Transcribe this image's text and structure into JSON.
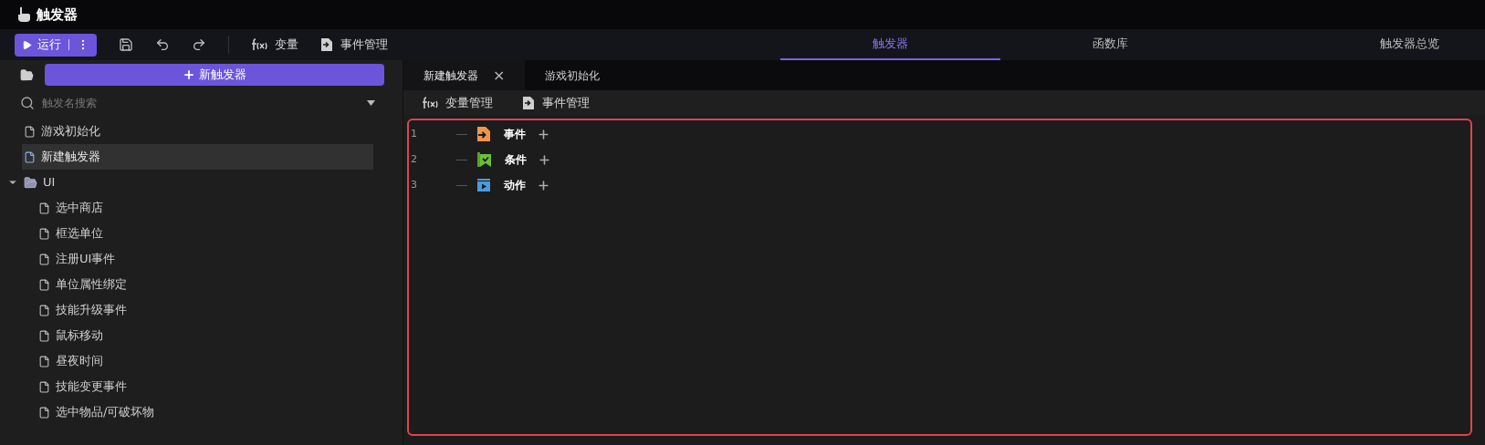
{
  "window": {
    "title": "触发器"
  },
  "toolbar": {
    "run_button": "运行",
    "items": [
      {
        "kind": "fx",
        "label": "变量"
      },
      {
        "kind": "event",
        "label": "事件管理"
      }
    ]
  },
  "top_tabs": [
    {
      "label": "触发器",
      "selected": true
    },
    {
      "label": "函数库",
      "selected": false
    },
    {
      "label": "触发器总览",
      "selected": false
    }
  ],
  "sidebar": {
    "new_button": "新触发器",
    "search": {
      "placeholder": "触发名搜索"
    },
    "items": [
      {
        "kind": "file",
        "label": "游戏初始化",
        "selected": false
      },
      {
        "kind": "file",
        "label": "新建触发器",
        "selected": true
      },
      {
        "kind": "folder",
        "label": "UI",
        "expanded": true,
        "children": [
          {
            "kind": "file",
            "label": "选中商店",
            "selected": false
          },
          {
            "kind": "file",
            "label": "框选单位",
            "selected": false
          },
          {
            "kind": "file",
            "label": "注册UI事件",
            "selected": false
          },
          {
            "kind": "file",
            "label": "单位属性绑定",
            "selected": false
          },
          {
            "kind": "file",
            "label": "技能升级事件",
            "selected": false
          },
          {
            "kind": "file",
            "label": "鼠标移动",
            "selected": false
          },
          {
            "kind": "file",
            "label": "昼夜时间",
            "selected": false
          },
          {
            "kind": "file",
            "label": "技能变更事件",
            "selected": false
          },
          {
            "kind": "file",
            "label": "选中物品/可破坏物",
            "selected": false
          }
        ]
      }
    ]
  },
  "editor_tabs": [
    {
      "label": "新建触发器",
      "selected": true,
      "close": "×"
    },
    {
      "label": "游戏初始化",
      "selected": false
    }
  ],
  "editor_toolbar": [
    {
      "kind": "fx",
      "label": "变量管理"
    },
    {
      "kind": "event",
      "label": "事件管理"
    }
  ],
  "editor_rows": [
    {
      "line": "1",
      "kind": "event",
      "label": "事件"
    },
    {
      "line": "2",
      "kind": "condition",
      "label": "条件"
    },
    {
      "line": "3",
      "kind": "action",
      "label": "动作"
    }
  ]
}
